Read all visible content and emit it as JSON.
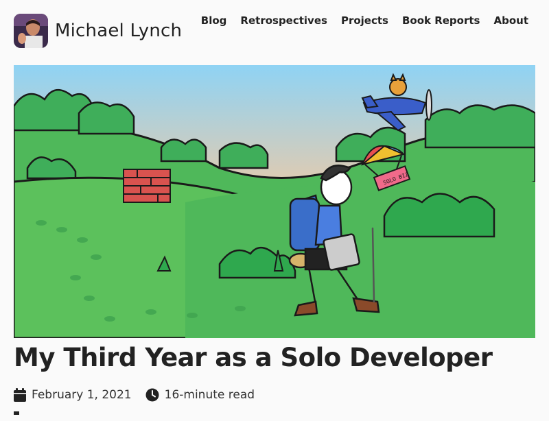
{
  "site": {
    "name": "Michael Lynch"
  },
  "nav": {
    "items": [
      "Blog",
      "Retrospectives",
      "Projects",
      "Book Reports",
      "About"
    ]
  },
  "hero": {
    "sign_text": "SOLO BIZ"
  },
  "post": {
    "title": "My Third Year as a Solo Developer",
    "date": "February 1, 2021",
    "read_time": "16-minute read"
  },
  "icons": {
    "date": "calendar-icon",
    "read_time": "clock-icon"
  },
  "colors": {
    "sky_top": "#8fd3f4",
    "sky_bottom": "#f5c9a0",
    "grass": "#5cc15c",
    "brick": "#d9534f",
    "text": "#222222"
  }
}
